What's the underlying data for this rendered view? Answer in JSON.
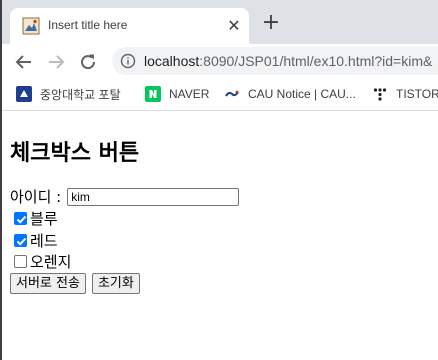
{
  "browser": {
    "tab_title": "Insert title here",
    "close_symbol": "✕",
    "new_tab_symbol": "+",
    "url_host": "localhost",
    "url_rest": ":8090/JSP01/html/ex10.html?id=kim&"
  },
  "bookmarks": [
    {
      "label": "중앙대학교 포탈",
      "icon": "cau-portal-icon"
    },
    {
      "label": "NAVER",
      "icon": "naver-icon"
    },
    {
      "label": "CAU Notice | CAU...",
      "icon": "cau-notice-icon"
    },
    {
      "label": "TISTORY",
      "icon": "tistory-icon"
    }
  ],
  "page": {
    "heading": "체크박스 버튼",
    "id_label": "아이디 :",
    "id_value": "kim",
    "checkboxes": [
      {
        "label": "블루",
        "checked": true
      },
      {
        "label": "레드",
        "checked": true
      },
      {
        "label": "오렌지",
        "checked": false
      }
    ],
    "submit_label": "서버로 전송",
    "reset_label": "초기화"
  },
  "colors": {
    "accent": "#0075ff",
    "tabstrip": "#dee1e6",
    "omnibox": "#f1f3f4"
  }
}
